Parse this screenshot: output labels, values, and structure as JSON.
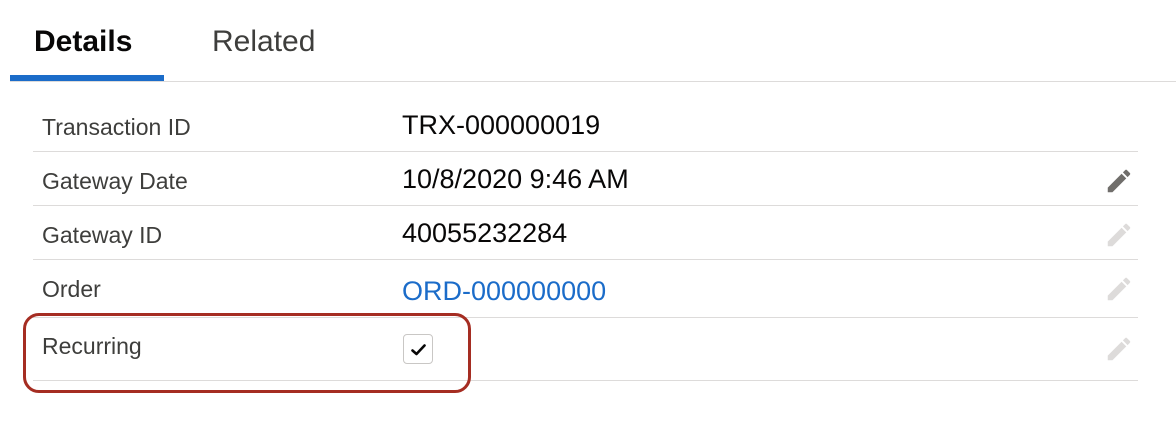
{
  "tabs": [
    {
      "label": "Details",
      "active": true
    },
    {
      "label": "Related",
      "active": false
    }
  ],
  "fields": [
    {
      "label": "Transaction ID",
      "value": "TRX-000000019",
      "editable": false
    },
    {
      "label": "Gateway Date",
      "value": "10/8/2020 9:46 AM",
      "editable": true
    },
    {
      "label": "Gateway ID",
      "value": "40055232284",
      "editable": true
    },
    {
      "label": "Order",
      "value": "ORD-000000000",
      "editable": true,
      "link": true
    },
    {
      "label": "Recurring",
      "checked": true,
      "editable": true
    }
  ],
  "colors": {
    "accent": "#1b6cc9",
    "highlight": "#a52d22",
    "divider": "#dddbda",
    "pencil_active": "#706e6b",
    "pencil_faded": "#dddbda"
  },
  "icons": {
    "edit": "pencil-icon",
    "check": "checkmark-icon"
  }
}
